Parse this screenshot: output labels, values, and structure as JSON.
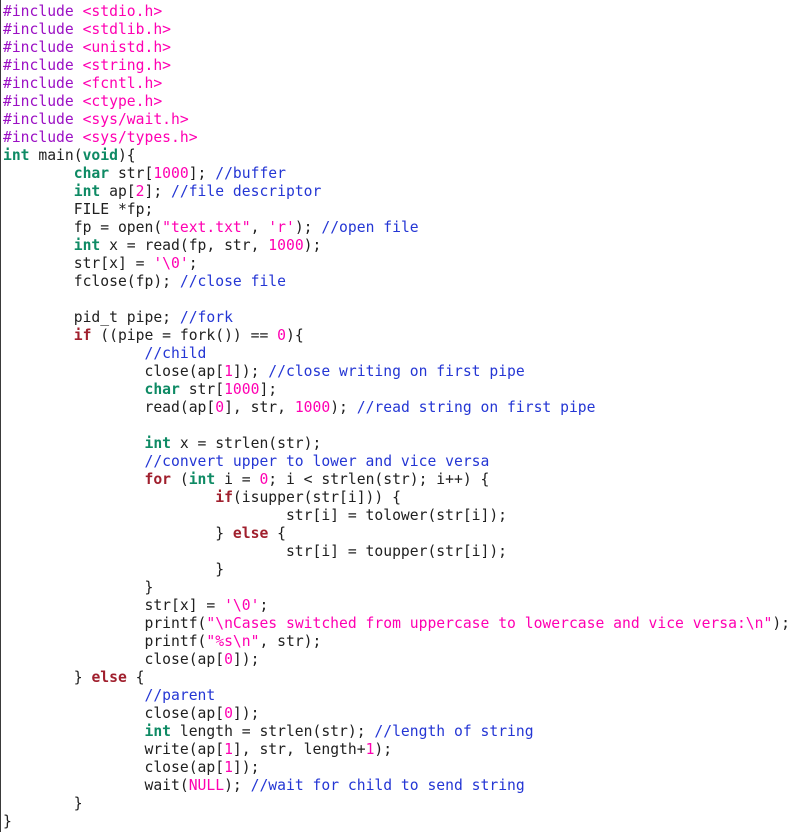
{
  "editor": {
    "language": "C",
    "tab_width": 8,
    "background": "#ffffff",
    "foreground": "#202020"
  },
  "palette": {
    "preprocessor": "#9b0fc4",
    "header_name": "#ff00b2",
    "type_keyword": "#0e8a64",
    "control_keyword": "#a01f2d",
    "number": "#ff00b2",
    "string": "#ff00b2",
    "constant": "#ff00b2",
    "comment": "#2436d4",
    "plain_text": "#202020"
  },
  "code": {
    "lines": [
      {
        "tokens": [
          {
            "t": "#include ",
            "c": "pp"
          },
          {
            "t": "<stdio.h>",
            "c": "header"
          }
        ]
      },
      {
        "tokens": [
          {
            "t": "#include ",
            "c": "pp"
          },
          {
            "t": "<stdlib.h>",
            "c": "header"
          }
        ]
      },
      {
        "tokens": [
          {
            "t": "#include ",
            "c": "pp"
          },
          {
            "t": "<unistd.h>",
            "c": "header"
          }
        ]
      },
      {
        "tokens": [
          {
            "t": "#include ",
            "c": "pp"
          },
          {
            "t": "<string.h>",
            "c": "header"
          }
        ]
      },
      {
        "tokens": [
          {
            "t": "#include ",
            "c": "pp"
          },
          {
            "t": "<fcntl.h>",
            "c": "header"
          }
        ]
      },
      {
        "tokens": [
          {
            "t": "#include ",
            "c": "pp"
          },
          {
            "t": "<ctype.h>",
            "c": "header"
          }
        ]
      },
      {
        "tokens": [
          {
            "t": "#include ",
            "c": "pp"
          },
          {
            "t": "<sys/wait.h>",
            "c": "header"
          }
        ]
      },
      {
        "tokens": [
          {
            "t": "#include ",
            "c": "pp"
          },
          {
            "t": "<sys/types.h>",
            "c": "header"
          }
        ]
      },
      {
        "tokens": [
          {
            "t": "int",
            "c": "type"
          },
          {
            "t": " main(",
            "c": "plain"
          },
          {
            "t": "void",
            "c": "type"
          },
          {
            "t": "){",
            "c": "plain"
          }
        ]
      },
      {
        "tokens": [
          {
            "t": "        ",
            "c": "plain"
          },
          {
            "t": "char",
            "c": "type"
          },
          {
            "t": " str[",
            "c": "plain"
          },
          {
            "t": "1000",
            "c": "number"
          },
          {
            "t": "]; ",
            "c": "plain"
          },
          {
            "t": "//buffer",
            "c": "comment"
          }
        ]
      },
      {
        "tokens": [
          {
            "t": "        ",
            "c": "plain"
          },
          {
            "t": "int",
            "c": "type"
          },
          {
            "t": " ap[",
            "c": "plain"
          },
          {
            "t": "2",
            "c": "number"
          },
          {
            "t": "]; ",
            "c": "plain"
          },
          {
            "t": "//file descriptor",
            "c": "comment"
          }
        ]
      },
      {
        "tokens": [
          {
            "t": "        FILE *fp;",
            "c": "plain"
          }
        ]
      },
      {
        "tokens": [
          {
            "t": "        fp = open(",
            "c": "plain"
          },
          {
            "t": "\"text.txt\"",
            "c": "string"
          },
          {
            "t": ", ",
            "c": "plain"
          },
          {
            "t": "'r'",
            "c": "string"
          },
          {
            "t": "); ",
            "c": "plain"
          },
          {
            "t": "//open file",
            "c": "comment"
          }
        ]
      },
      {
        "tokens": [
          {
            "t": "        ",
            "c": "plain"
          },
          {
            "t": "int",
            "c": "type"
          },
          {
            "t": " x = read(fp, str, ",
            "c": "plain"
          },
          {
            "t": "1000",
            "c": "number"
          },
          {
            "t": ");",
            "c": "plain"
          }
        ]
      },
      {
        "tokens": [
          {
            "t": "        str[x] = ",
            "c": "plain"
          },
          {
            "t": "'\\0'",
            "c": "string"
          },
          {
            "t": ";",
            "c": "plain"
          }
        ]
      },
      {
        "tokens": [
          {
            "t": "        fclose(fp); ",
            "c": "plain"
          },
          {
            "t": "//close file",
            "c": "comment"
          }
        ]
      },
      {
        "tokens": []
      },
      {
        "tokens": [
          {
            "t": "        pid_t pipe; ",
            "c": "plain"
          },
          {
            "t": "//fork",
            "c": "comment"
          }
        ]
      },
      {
        "tokens": [
          {
            "t": "        ",
            "c": "plain"
          },
          {
            "t": "if",
            "c": "control"
          },
          {
            "t": " ((pipe = fork()) == ",
            "c": "plain"
          },
          {
            "t": "0",
            "c": "number"
          },
          {
            "t": "){",
            "c": "plain"
          }
        ]
      },
      {
        "tokens": [
          {
            "t": "                ",
            "c": "plain"
          },
          {
            "t": "//child",
            "c": "comment"
          }
        ]
      },
      {
        "tokens": [
          {
            "t": "                close(ap[",
            "c": "plain"
          },
          {
            "t": "1",
            "c": "number"
          },
          {
            "t": "]); ",
            "c": "plain"
          },
          {
            "t": "//close writing on first pipe",
            "c": "comment"
          }
        ]
      },
      {
        "tokens": [
          {
            "t": "                ",
            "c": "plain"
          },
          {
            "t": "char",
            "c": "type"
          },
          {
            "t": " str[",
            "c": "plain"
          },
          {
            "t": "1000",
            "c": "number"
          },
          {
            "t": "];",
            "c": "plain"
          }
        ]
      },
      {
        "tokens": [
          {
            "t": "                read(ap[",
            "c": "plain"
          },
          {
            "t": "0",
            "c": "number"
          },
          {
            "t": "], str, ",
            "c": "plain"
          },
          {
            "t": "1000",
            "c": "number"
          },
          {
            "t": "); ",
            "c": "plain"
          },
          {
            "t": "//read string on first pipe",
            "c": "comment"
          }
        ]
      },
      {
        "tokens": []
      },
      {
        "tokens": [
          {
            "t": "                ",
            "c": "plain"
          },
          {
            "t": "int",
            "c": "type"
          },
          {
            "t": " x = strlen(str);",
            "c": "plain"
          }
        ]
      },
      {
        "tokens": [
          {
            "t": "                ",
            "c": "plain"
          },
          {
            "t": "//convert upper to lower and vice versa",
            "c": "comment"
          }
        ]
      },
      {
        "tokens": [
          {
            "t": "                ",
            "c": "plain"
          },
          {
            "t": "for",
            "c": "control"
          },
          {
            "t": " (",
            "c": "plain"
          },
          {
            "t": "int",
            "c": "type"
          },
          {
            "t": " i = ",
            "c": "plain"
          },
          {
            "t": "0",
            "c": "number"
          },
          {
            "t": "; i < strlen(str); i++) {",
            "c": "plain"
          }
        ]
      },
      {
        "tokens": [
          {
            "t": "                        ",
            "c": "plain"
          },
          {
            "t": "if",
            "c": "control"
          },
          {
            "t": "(isupper(str[i])) {",
            "c": "plain"
          }
        ]
      },
      {
        "tokens": [
          {
            "t": "                                str[i] = tolower(str[i]);",
            "c": "plain"
          }
        ]
      },
      {
        "tokens": [
          {
            "t": "                        } ",
            "c": "plain"
          },
          {
            "t": "else",
            "c": "control"
          },
          {
            "t": " {",
            "c": "plain"
          }
        ]
      },
      {
        "tokens": [
          {
            "t": "                                str[i] = toupper(str[i]);",
            "c": "plain"
          }
        ]
      },
      {
        "tokens": [
          {
            "t": "                        }",
            "c": "plain"
          }
        ]
      },
      {
        "tokens": [
          {
            "t": "                }",
            "c": "plain"
          }
        ]
      },
      {
        "tokens": [
          {
            "t": "                str[x] = ",
            "c": "plain"
          },
          {
            "t": "'\\0'",
            "c": "string"
          },
          {
            "t": ";",
            "c": "plain"
          }
        ]
      },
      {
        "tokens": [
          {
            "t": "                printf(",
            "c": "plain"
          },
          {
            "t": "\"\\nCases switched from uppercase to lowercase and vice versa:\\n\"",
            "c": "string"
          },
          {
            "t": ");",
            "c": "plain"
          }
        ]
      },
      {
        "tokens": [
          {
            "t": "                printf(",
            "c": "plain"
          },
          {
            "t": "\"%s\\n\"",
            "c": "string"
          },
          {
            "t": ", str);",
            "c": "plain"
          }
        ]
      },
      {
        "tokens": [
          {
            "t": "                close(ap[",
            "c": "plain"
          },
          {
            "t": "0",
            "c": "number"
          },
          {
            "t": "]);",
            "c": "plain"
          }
        ]
      },
      {
        "tokens": [
          {
            "t": "        } ",
            "c": "plain"
          },
          {
            "t": "else",
            "c": "control"
          },
          {
            "t": " {",
            "c": "plain"
          }
        ]
      },
      {
        "tokens": [
          {
            "t": "                ",
            "c": "plain"
          },
          {
            "t": "//parent",
            "c": "comment"
          }
        ]
      },
      {
        "tokens": [
          {
            "t": "                close(ap[",
            "c": "plain"
          },
          {
            "t": "0",
            "c": "number"
          },
          {
            "t": "]);",
            "c": "plain"
          }
        ]
      },
      {
        "tokens": [
          {
            "t": "                ",
            "c": "plain"
          },
          {
            "t": "int",
            "c": "type"
          },
          {
            "t": " length = strlen(str); ",
            "c": "plain"
          },
          {
            "t": "//length of string",
            "c": "comment"
          }
        ]
      },
      {
        "tokens": [
          {
            "t": "                write(ap[",
            "c": "plain"
          },
          {
            "t": "1",
            "c": "number"
          },
          {
            "t": "], str, length+",
            "c": "plain"
          },
          {
            "t": "1",
            "c": "number"
          },
          {
            "t": ");",
            "c": "plain"
          }
        ]
      },
      {
        "tokens": [
          {
            "t": "                close(ap[",
            "c": "plain"
          },
          {
            "t": "1",
            "c": "number"
          },
          {
            "t": "]);",
            "c": "plain"
          }
        ]
      },
      {
        "tokens": [
          {
            "t": "                wait(",
            "c": "plain"
          },
          {
            "t": "NULL",
            "c": "const"
          },
          {
            "t": "); ",
            "c": "plain"
          },
          {
            "t": "//wait for child to send string",
            "c": "comment"
          }
        ]
      },
      {
        "tokens": [
          {
            "t": "        }",
            "c": "plain"
          }
        ]
      },
      {
        "tokens": [
          {
            "t": "}",
            "c": "plain"
          }
        ]
      }
    ]
  }
}
